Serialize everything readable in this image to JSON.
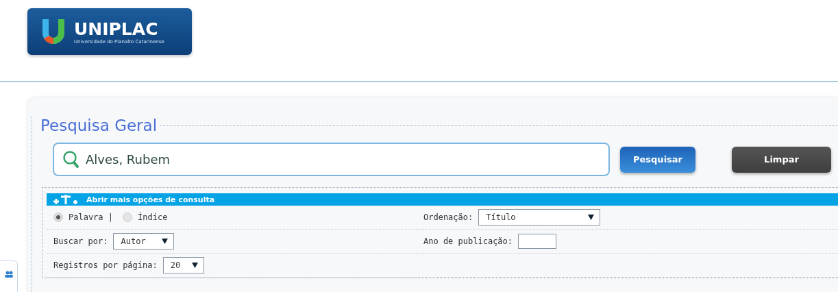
{
  "logo": {
    "name": "UNIPLAC",
    "subtitle": "Universidade do Planalto Catarinense"
  },
  "search": {
    "title": "Pesquisa Geral",
    "value": "Alves, Rubem",
    "buttons": [
      {
        "label": "Pesquisar",
        "kind": "primary"
      },
      {
        "label": "Limpar",
        "kind": "secondary"
      }
    ]
  },
  "options": {
    "toggle": "Abrir mais opções de consulta",
    "mode": [
      {
        "label": "Palavra |",
        "selected": true
      },
      {
        "label": "Índice",
        "selected": false
      }
    ],
    "search_by": {
      "label": "Buscar por:",
      "value": "Autor"
    },
    "per_page": {
      "label": "Registros por página:",
      "value": "20"
    },
    "sort": {
      "label": "Ordenação:",
      "value": "Título"
    },
    "year": {
      "label": "Ano de publicação:"
    }
  }
}
